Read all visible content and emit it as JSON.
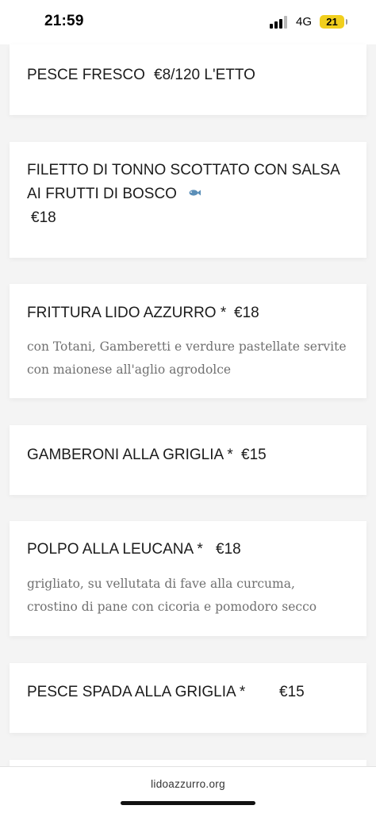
{
  "status_bar": {
    "time": "21:59",
    "network": "4G",
    "battery": "21",
    "signal_icon": "signal-bars-icon",
    "battery_color": "#f1cf1d"
  },
  "menu": {
    "items": [
      {
        "title": "PESCE FRESCO",
        "price": "€8/120 L'ETTO"
      },
      {
        "title_line1": "FILETTO DI TONNO SCOTTATO CON SALSA",
        "title_line2": "AI FRUTTI DI BOSCO",
        "icon": "fish-icon",
        "price": "€18"
      },
      {
        "title": "FRITTURA LIDO AZZURRO *",
        "price": "€18",
        "desc_line1": "con Totani, Gamberetti e verdure pastellate servite",
        "desc_line2": "con maionese all'aglio agrodolce"
      },
      {
        "title": "GAMBERONI ALLA GRIGLIA *",
        "price": "€15"
      },
      {
        "title": "POLPO ALLA LEUCANA *",
        "price": "€18",
        "desc_line1": "grigliato, su vellutata di fave alla curcuma,",
        "desc_line2": "crostino di pane con cicoria e pomodoro secco"
      },
      {
        "title": "PESCE SPADA ALLA GRIGLIA *",
        "price": "€15"
      }
    ]
  },
  "browser": {
    "url": "lidoazzurro.org"
  }
}
